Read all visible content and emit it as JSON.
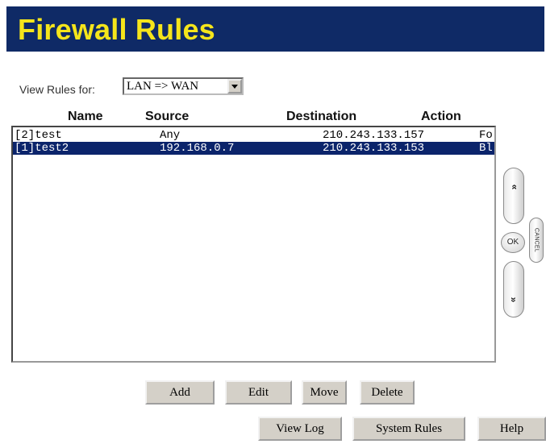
{
  "header": {
    "title": "Firewall Rules"
  },
  "filter": {
    "label": "View Rules for:",
    "selected": "LAN => WAN"
  },
  "columns": {
    "name": "Name",
    "source": "Source",
    "destination": "Destination",
    "action": "Action"
  },
  "rules": [
    {
      "name": "[2]test",
      "source": "Any",
      "destination": "210.243.133.157",
      "action": "Fo",
      "selected": false
    },
    {
      "name": "[1]test2",
      "source": "192.168.0.7",
      "destination": "210.243.133.153",
      "action": "Bl",
      "selected": true
    }
  ],
  "buttons": {
    "add": "Add",
    "edit": "Edit",
    "move": "Move",
    "delete": "Delete"
  },
  "footer": {
    "view_log": "View Log",
    "system_rules": "System Rules",
    "help": "Help"
  },
  "side_controls": {
    "up": "»",
    "ok": "OK",
    "cancel": "CANCEL",
    "down": "»"
  },
  "colors": {
    "banner": "#0f2a66",
    "title": "#f5e51b",
    "selection": "#0b246b"
  }
}
